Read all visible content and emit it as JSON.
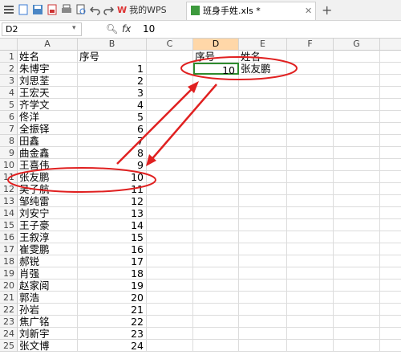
{
  "toolbar": {
    "icons": [
      "app-menu-icon",
      "new-icon",
      "save-icon",
      "export-pdf-icon",
      "print-icon",
      "print-preview-icon",
      "undo-icon",
      "redo-icon",
      "brush-icon"
    ],
    "tabs": [
      {
        "label": "我的WPS",
        "active": false
      },
      {
        "label": "班身手姓.xls *",
        "active": true
      }
    ],
    "new_tab_label": "+"
  },
  "formula_bar": {
    "name_box": "D2",
    "fx_label": "fx",
    "value": "10"
  },
  "sheet": {
    "columns": [
      "A",
      "B",
      "C",
      "D",
      "E",
      "F",
      "G"
    ],
    "selected_column": "D",
    "rows": [
      "1",
      "2",
      "3",
      "4",
      "5",
      "6",
      "7",
      "8",
      "9",
      "10",
      "11",
      "12",
      "13",
      "14",
      "15",
      "16",
      "17",
      "18",
      "19",
      "20",
      "21",
      "22",
      "23",
      "24",
      "25"
    ],
    "col_a": [
      "姓名",
      "朱博宇",
      "刘思荃",
      "王宏天",
      "齐学文",
      "佟洋",
      "全振铎",
      "田鑫",
      "曲金鑫",
      "王喜伟",
      "张友鹏",
      "吴子航",
      "邹纯雷",
      "刘安宁",
      "王子豪",
      "王叙淳",
      "崔雯鹏",
      "郝锐",
      "肖强",
      "赵家阅",
      "郭浩",
      "孙岩",
      "焦广铭",
      "刘新宇",
      "张文博"
    ],
    "col_b": [
      "序号",
      "1",
      "2",
      "3",
      "4",
      "5",
      "6",
      "7",
      "8",
      "9",
      "10",
      "11",
      "12",
      "13",
      "14",
      "15",
      "16",
      "17",
      "18",
      "19",
      "20",
      "21",
      "22",
      "23",
      "24"
    ],
    "d1": "序号",
    "e1": "姓名",
    "d2": "10",
    "e2": "张友鹏"
  },
  "annotation_color": "#e02020",
  "selection_color": "#2e8b2e"
}
